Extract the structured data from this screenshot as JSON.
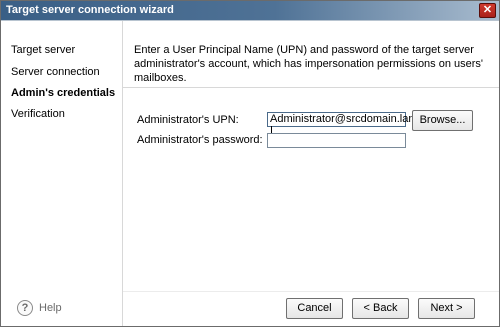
{
  "window": {
    "title": "Target server connection wizard",
    "close_glyph": "✕"
  },
  "sidebar": {
    "items": [
      {
        "label": "Target server",
        "active": false
      },
      {
        "label": "Server connection",
        "active": false
      },
      {
        "label": "Admin's credentials",
        "active": true
      },
      {
        "label": "Verification",
        "active": false
      }
    ],
    "help_label": "Help",
    "help_glyph": "?"
  },
  "main": {
    "intro_text": "Enter a User Principal Name (UPN) and password of the target server administrator's account, which has impersonation permissions on users' mailboxes.",
    "upn_label": "Administrator's UPN:",
    "upn_value": "Administrator@srcdomain.lan",
    "password_label": "Administrator's password:",
    "password_value": "",
    "browse_label": "Browse..."
  },
  "footer": {
    "cancel_label": "Cancel",
    "back_label": "< Back",
    "next_label": "Next >"
  },
  "icons": {
    "close": "close-icon",
    "help": "help-icon"
  },
  "colors": {
    "titlebar_start": "#3a5f86",
    "titlebar_end": "#a9bccf",
    "close_button": "#cf3a2e"
  }
}
